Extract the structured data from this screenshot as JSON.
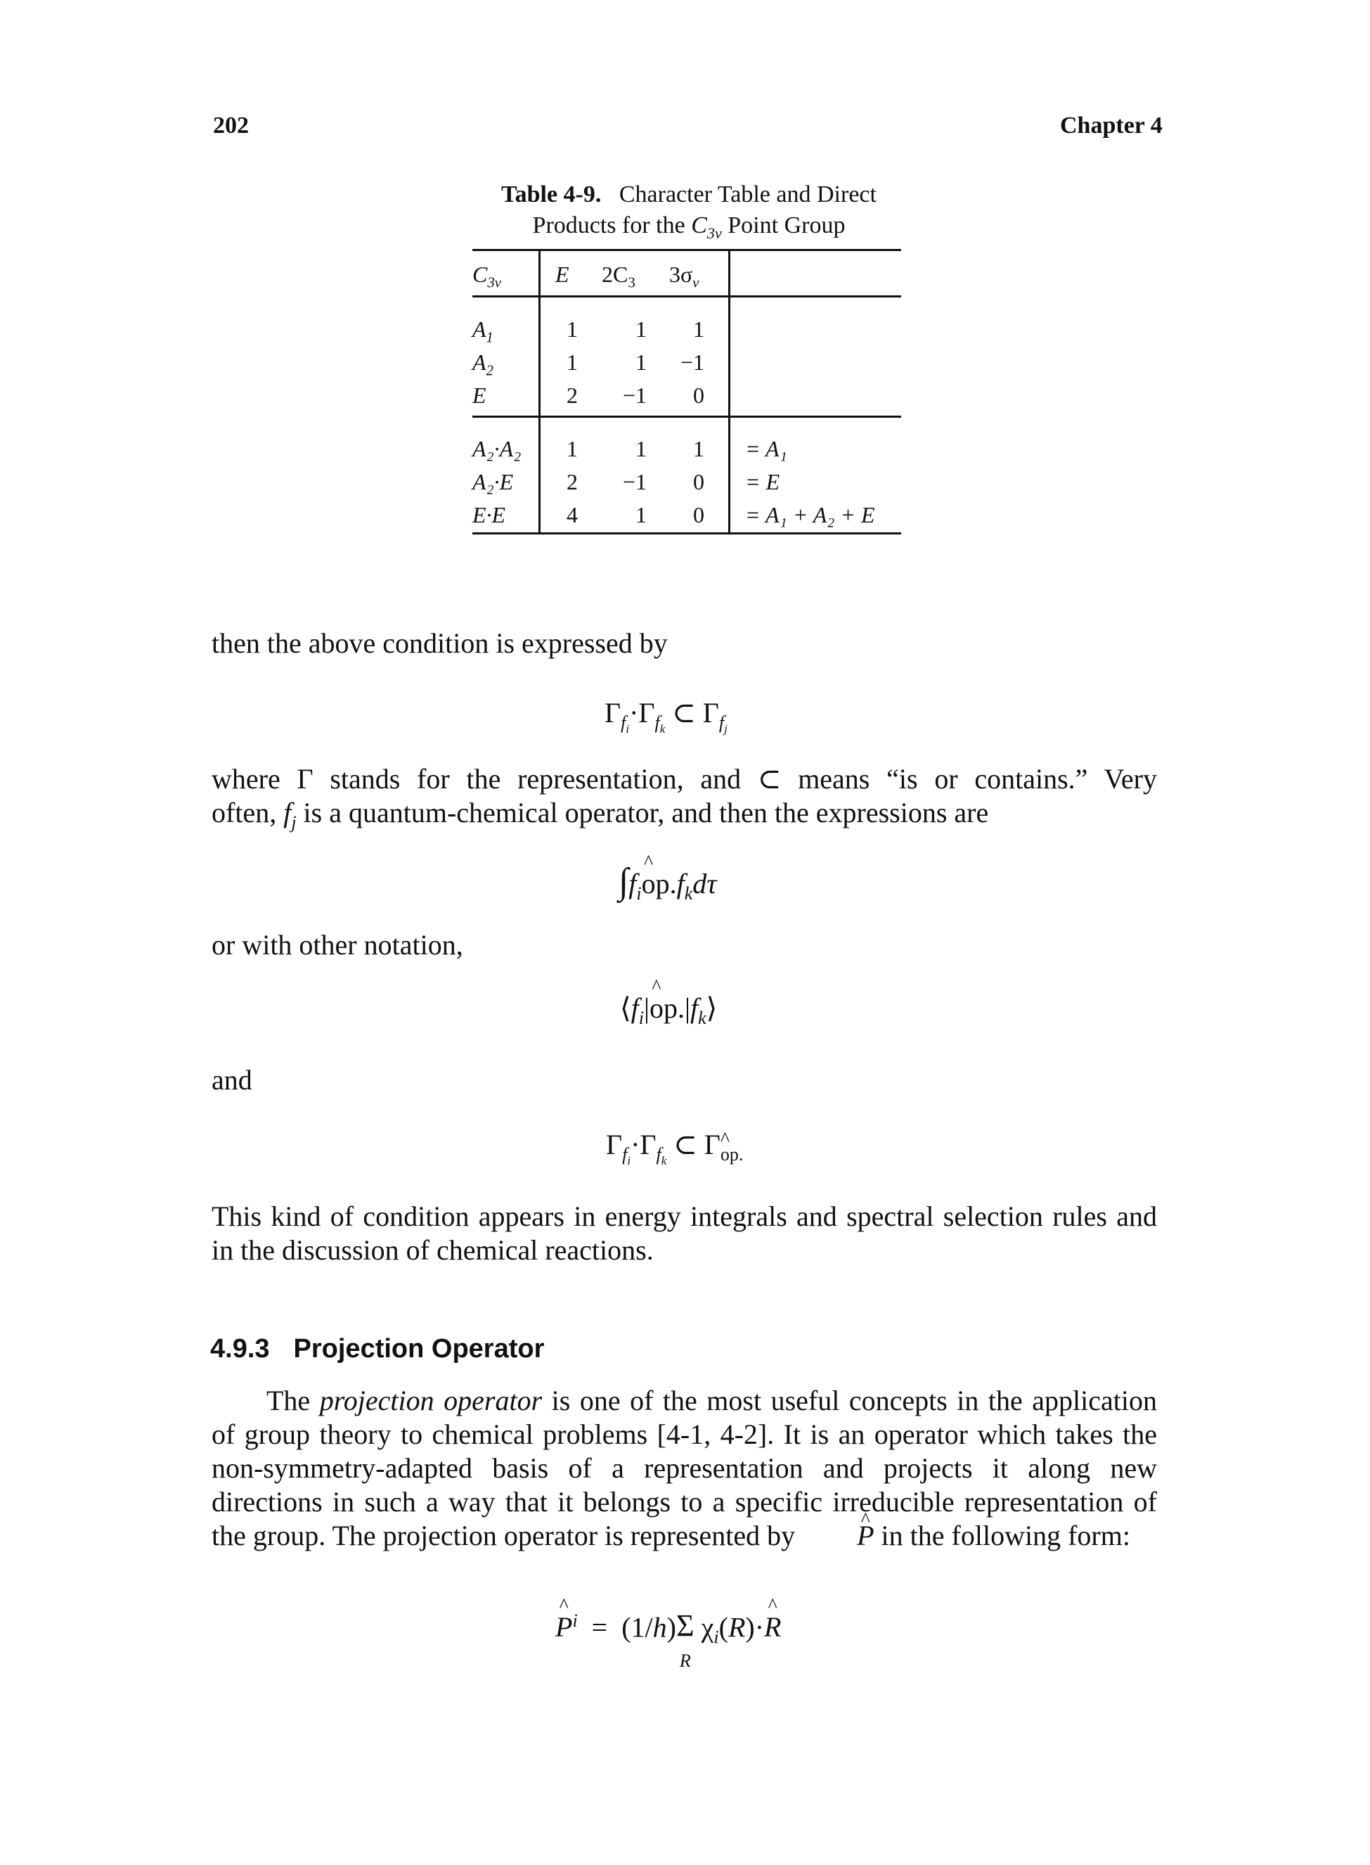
{
  "header": {
    "page_number": "202",
    "chapter": "Chapter 4"
  },
  "table": {
    "caption_label": "Table 4-9.",
    "caption_line1": "Character Table and Direct",
    "caption_line2_pre": "Products for the ",
    "caption_group": "C",
    "caption_group_sub": "3v",
    "caption_line2_post": " Point Group",
    "corner": "C",
    "corner_sub": "3v",
    "columns": [
      {
        "main": "E",
        "sub": ""
      },
      {
        "main": "2C",
        "sub": "3"
      },
      {
        "main": "3σ",
        "sub": "v"
      }
    ],
    "irreps": [
      {
        "label": "A",
        "sub": "1",
        "values": [
          "1",
          "1",
          "1"
        ]
      },
      {
        "label": "A",
        "sub": "2",
        "values": [
          "1",
          "1",
          "−1"
        ]
      },
      {
        "label": "E",
        "sub": "",
        "values": [
          "2",
          "−1",
          "0"
        ]
      }
    ],
    "products": [
      {
        "label": "A₂·A₂",
        "values": [
          "1",
          "1",
          "1"
        ],
        "result": "= A₁"
      },
      {
        "label": "A₂·E",
        "values": [
          "2",
          "−1",
          "0"
        ],
        "result": "= E"
      },
      {
        "label": "E·E",
        "values": [
          "4",
          "1",
          "0"
        ],
        "result": "= A₁ + A₂ + E"
      }
    ]
  },
  "text": {
    "p1": "then the above condition is expressed by",
    "eq1": "Γfi·Γfk ⊂ Γfj",
    "p2_line1": "where Γ stands for the representation, and ⊂ means “is or contains.” Very",
    "p2_line2_pre": "often, ",
    "p2_line2_var": "f",
    "p2_line2_sub": "j",
    "p2_line2_post": " is a quantum-chemical operator, and then the expressions are",
    "eq2": "∫ fi op̂. fk dτ",
    "p3": "or with other notation,",
    "eq3": "⟨fi|op̂.|fk⟩",
    "p4": "and",
    "eq4": "Γfi·Γfk ⊂ Γop̂.",
    "p5": "This kind of condition appears in energy integrals and spectral selection rules and in the discussion of chemical reactions."
  },
  "section": {
    "number": "4.9.3",
    "title": "Projection Operator",
    "para_pre": "The ",
    "para_em": "projection operator",
    "para_post": " is one of the most useful concepts in the application of group theory to chemical problems [4-1, 4-2]. It is an operator which takes the non-symmetry-adapted basis of a representation and projects it along new directions in such a way that it belongs to a specific irreducible representation of the group. The projection operator is represented by ",
    "para_sym": "P",
    "para_end": " in the following form:",
    "formula": "P̂ⁱ = (1/h) Σ_R χi(R)·R̂"
  }
}
